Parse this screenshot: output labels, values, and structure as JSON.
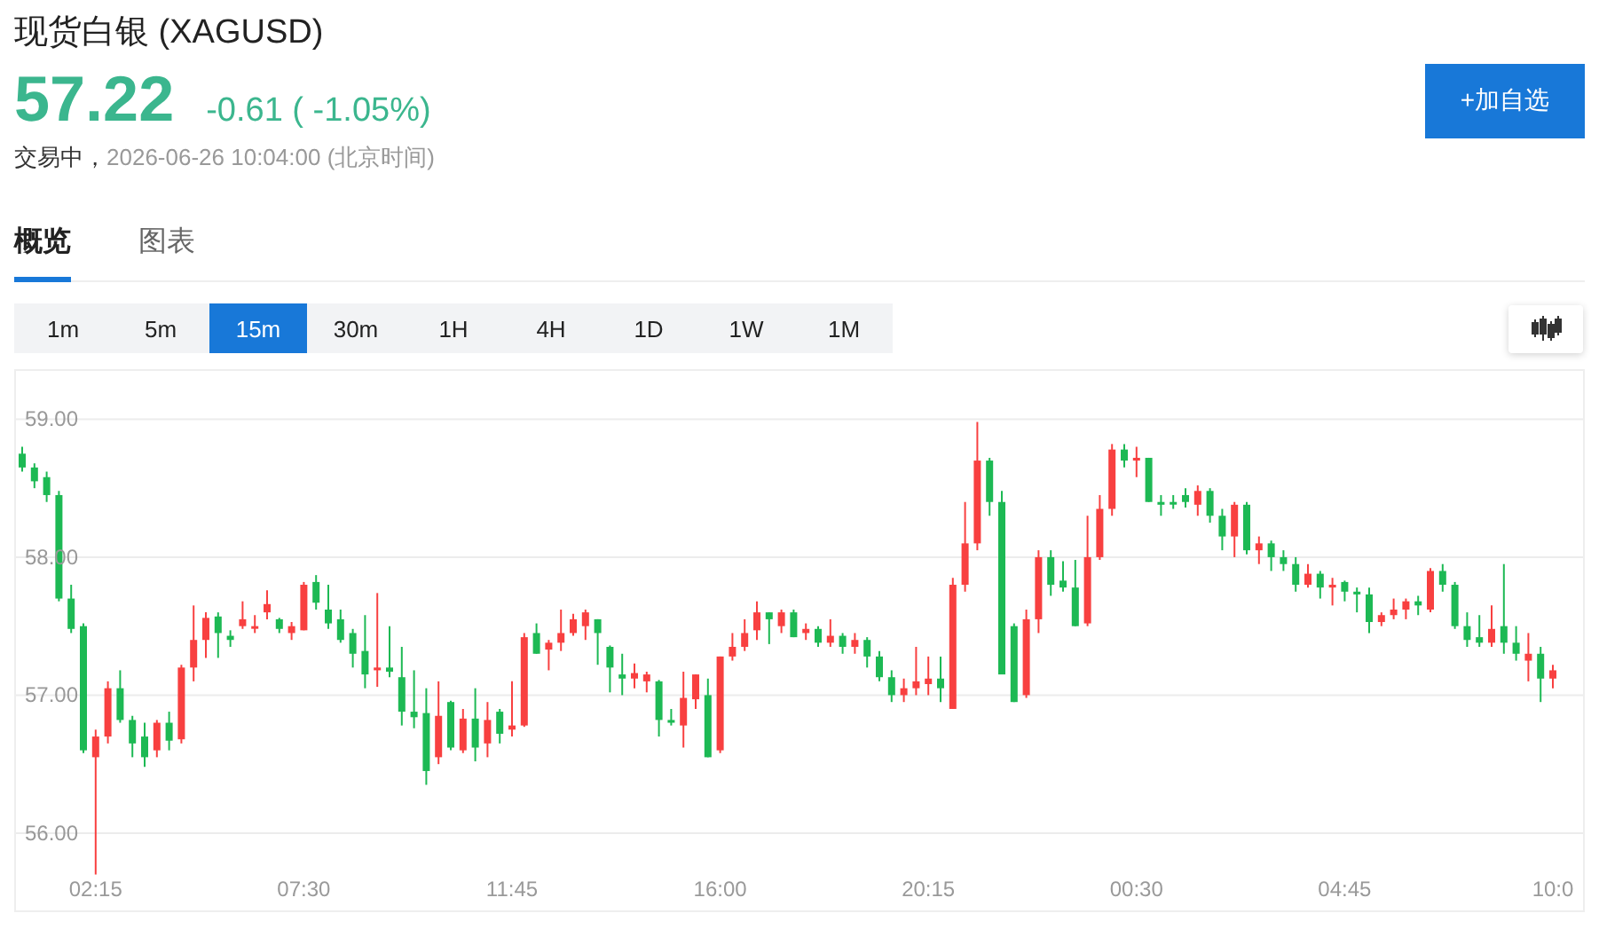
{
  "title": "现货白银 (XAGUSD)",
  "quote": {
    "price": "57.22",
    "change": "-0.61 ( -1.05%)"
  },
  "status": {
    "state": "交易中，",
    "time": "2026-06-26 10:04:00 (北京时间)"
  },
  "add_button": "+加自选",
  "tabs": [
    {
      "label": "概览",
      "selected": true
    },
    {
      "label": "图表",
      "selected": false
    }
  ],
  "intervals": [
    {
      "label": "1m",
      "selected": false
    },
    {
      "label": "5m",
      "selected": false
    },
    {
      "label": "15m",
      "selected": true
    },
    {
      "label": "30m",
      "selected": false
    },
    {
      "label": "1H",
      "selected": false
    },
    {
      "label": "4H",
      "selected": false
    },
    {
      "label": "1D",
      "selected": false
    },
    {
      "label": "1W",
      "selected": false
    },
    {
      "label": "1M",
      "selected": false
    }
  ],
  "chart": {
    "chart_data": {
      "type": "candlestick",
      "categories": [
        null,
        null,
        null,
        null,
        null,
        null,
        "02:15",
        null,
        null,
        null,
        null,
        null,
        null,
        null,
        null,
        null,
        null,
        null,
        null,
        null,
        null,
        null,
        null,
        "07:30",
        null,
        null,
        null,
        null,
        null,
        null,
        null,
        null,
        null,
        null,
        null,
        null,
        null,
        null,
        null,
        null,
        "11:45",
        null,
        null,
        null,
        null,
        null,
        null,
        null,
        null,
        null,
        null,
        null,
        null,
        null,
        null,
        null,
        null,
        "16:00",
        null,
        null,
        null,
        null,
        null,
        null,
        null,
        null,
        null,
        null,
        null,
        null,
        null,
        null,
        null,
        null,
        "20:15",
        null,
        null,
        null,
        null,
        null,
        null,
        null,
        null,
        null,
        null,
        null,
        null,
        null,
        null,
        null,
        null,
        "00:30",
        null,
        null,
        null,
        null,
        null,
        null,
        null,
        null,
        null,
        null,
        null,
        null,
        null,
        null,
        null,
        null,
        "04:45",
        null,
        null,
        null,
        null,
        null,
        null,
        null,
        null,
        null,
        null,
        null,
        null,
        null,
        null,
        null,
        null,
        "10:0"
      ],
      "ohlc": [
        [
          58.75,
          58.8,
          58.62,
          58.65
        ],
        [
          58.65,
          58.68,
          58.5,
          58.55
        ],
        [
          58.58,
          58.62,
          58.4,
          58.45
        ],
        [
          58.45,
          58.48,
          57.68,
          57.7
        ],
        [
          57.7,
          57.8,
          57.45,
          57.48
        ],
        [
          57.5,
          57.52,
          56.58,
          56.6
        ],
        [
          56.55,
          56.75,
          55.7,
          56.7
        ],
        [
          56.7,
          57.1,
          56.65,
          57.05
        ],
        [
          57.05,
          57.18,
          56.8,
          56.82
        ],
        [
          56.82,
          56.85,
          56.55,
          56.65
        ],
        [
          56.7,
          56.8,
          56.48,
          56.55
        ],
        [
          56.6,
          56.82,
          56.55,
          56.8
        ],
        [
          56.8,
          56.88,
          56.6,
          56.67
        ],
        [
          56.68,
          57.22,
          56.65,
          57.2
        ],
        [
          57.2,
          57.65,
          57.1,
          57.4
        ],
        [
          57.4,
          57.6,
          57.27,
          57.56
        ],
        [
          57.57,
          57.6,
          57.27,
          57.45
        ],
        [
          57.43,
          57.47,
          57.35,
          57.4
        ],
        [
          57.5,
          57.68,
          57.48,
          57.55
        ],
        [
          57.5,
          57.58,
          57.45,
          57.5
        ],
        [
          57.6,
          57.76,
          57.55,
          57.66
        ],
        [
          57.55,
          57.56,
          57.45,
          57.48
        ],
        [
          57.45,
          57.53,
          57.4,
          57.5
        ],
        [
          57.47,
          57.82,
          57.47,
          57.8
        ],
        [
          57.82,
          57.87,
          57.62,
          57.67
        ],
        [
          57.62,
          57.8,
          57.48,
          57.52
        ],
        [
          57.55,
          57.62,
          57.38,
          57.4
        ],
        [
          57.45,
          57.48,
          57.2,
          57.3
        ],
        [
          57.32,
          57.58,
          57.05,
          57.15
        ],
        [
          57.18,
          57.74,
          57.06,
          57.2
        ],
        [
          57.2,
          57.5,
          57.13,
          57.17
        ],
        [
          57.13,
          57.35,
          56.78,
          56.88
        ],
        [
          56.88,
          57.18,
          56.76,
          56.84
        ],
        [
          56.87,
          57.05,
          56.35,
          56.45
        ],
        [
          56.55,
          57.1,
          56.5,
          56.85
        ],
        [
          56.95,
          56.96,
          56.6,
          56.62
        ],
        [
          56.6,
          56.9,
          56.58,
          56.83
        ],
        [
          56.83,
          57.05,
          56.52,
          56.62
        ],
        [
          56.65,
          56.95,
          56.55,
          56.82
        ],
        [
          56.88,
          56.9,
          56.65,
          56.72
        ],
        [
          56.75,
          57.1,
          56.7,
          56.78
        ],
        [
          56.78,
          57.45,
          56.77,
          57.42
        ],
        [
          57.45,
          57.52,
          57.3,
          57.3
        ],
        [
          57.33,
          57.4,
          57.18,
          57.38
        ],
        [
          57.38,
          57.62,
          57.32,
          57.45
        ],
        [
          57.45,
          57.59,
          57.43,
          57.55
        ],
        [
          57.5,
          57.62,
          57.4,
          57.6
        ],
        [
          57.55,
          57.55,
          57.22,
          57.45
        ],
        [
          57.35,
          57.36,
          57.02,
          57.2
        ],
        [
          57.15,
          57.3,
          57.0,
          57.12
        ],
        [
          57.12,
          57.23,
          57.05,
          57.16
        ],
        [
          57.1,
          57.17,
          57.02,
          57.15
        ],
        [
          57.1,
          57.11,
          56.7,
          56.82
        ],
        [
          56.82,
          56.9,
          56.78,
          56.8
        ],
        [
          56.78,
          57.17,
          56.62,
          56.98
        ],
        [
          56.97,
          57.15,
          56.9,
          57.15
        ],
        [
          57.0,
          57.12,
          56.55,
          56.55
        ],
        [
          56.6,
          57.28,
          56.58,
          57.28
        ],
        [
          57.28,
          57.45,
          57.25,
          57.35
        ],
        [
          57.35,
          57.55,
          57.32,
          57.45
        ],
        [
          57.47,
          57.68,
          57.4,
          57.6
        ],
        [
          57.6,
          57.6,
          57.37,
          57.55
        ],
        [
          57.5,
          57.62,
          57.45,
          57.6
        ],
        [
          57.6,
          57.62,
          57.42,
          57.42
        ],
        [
          57.45,
          57.52,
          57.4,
          57.48
        ],
        [
          57.48,
          57.5,
          57.35,
          57.38
        ],
        [
          57.38,
          57.55,
          57.35,
          57.43
        ],
        [
          57.43,
          57.45,
          57.3,
          57.35
        ],
        [
          57.35,
          57.45,
          57.3,
          57.4
        ],
        [
          57.4,
          57.42,
          57.2,
          57.28
        ],
        [
          57.28,
          57.32,
          57.1,
          57.13
        ],
        [
          57.13,
          57.18,
          56.95,
          57.0
        ],
        [
          57.0,
          57.12,
          56.95,
          57.05
        ],
        [
          57.05,
          57.35,
          57.0,
          57.1
        ],
        [
          57.08,
          57.28,
          57.0,
          57.12
        ],
        [
          57.12,
          57.28,
          56.95,
          57.05
        ],
        [
          56.9,
          57.85,
          56.9,
          57.8
        ],
        [
          57.8,
          58.4,
          57.75,
          58.1
        ],
        [
          58.1,
          58.98,
          58.05,
          58.7
        ],
        [
          58.7,
          58.72,
          58.3,
          58.4
        ],
        [
          58.4,
          58.48,
          57.15,
          57.15
        ],
        [
          57.5,
          57.52,
          56.95,
          56.95
        ],
        [
          57.0,
          57.62,
          56.98,
          57.55
        ],
        [
          57.55,
          58.05,
          57.45,
          58.0
        ],
        [
          58.0,
          58.05,
          57.72,
          57.8
        ],
        [
          57.83,
          57.97,
          57.75,
          57.78
        ],
        [
          57.78,
          57.98,
          57.5,
          57.5
        ],
        [
          57.52,
          58.3,
          57.5,
          58.0
        ],
        [
          58.0,
          58.45,
          57.98,
          58.35
        ],
        [
          58.35,
          58.82,
          58.3,
          58.78
        ],
        [
          58.78,
          58.82,
          58.65,
          58.7
        ],
        [
          58.7,
          58.8,
          58.58,
          58.72
        ],
        [
          58.72,
          58.72,
          58.4,
          58.4
        ],
        [
          58.4,
          58.45,
          58.3,
          58.38
        ],
        [
          58.4,
          58.45,
          58.35,
          58.39
        ],
        [
          58.45,
          58.5,
          58.36,
          58.4
        ],
        [
          58.38,
          58.52,
          58.3,
          58.48
        ],
        [
          58.48,
          58.5,
          58.25,
          58.3
        ],
        [
          58.3,
          58.35,
          58.05,
          58.15
        ],
        [
          58.15,
          58.4,
          58.0,
          58.38
        ],
        [
          58.38,
          58.4,
          58.02,
          58.05
        ],
        [
          58.05,
          58.15,
          57.95,
          58.1
        ],
        [
          58.1,
          58.12,
          57.9,
          58.0
        ],
        [
          58.0,
          58.05,
          57.9,
          57.95
        ],
        [
          57.95,
          58.0,
          57.75,
          57.8
        ],
        [
          57.8,
          57.95,
          57.78,
          57.88
        ],
        [
          57.88,
          57.9,
          57.7,
          57.78
        ],
        [
          57.78,
          57.85,
          57.65,
          57.8
        ],
        [
          57.82,
          57.83,
          57.68,
          57.75
        ],
        [
          57.75,
          57.78,
          57.6,
          57.73
        ],
        [
          57.73,
          57.78,
          57.45,
          57.53
        ],
        [
          57.53,
          57.6,
          57.5,
          57.58
        ],
        [
          57.58,
          57.7,
          57.55,
          57.62
        ],
        [
          57.62,
          57.7,
          57.55,
          57.68
        ],
        [
          57.68,
          57.72,
          57.58,
          57.65
        ],
        [
          57.62,
          57.92,
          57.6,
          57.9
        ],
        [
          57.9,
          57.95,
          57.75,
          57.8
        ],
        [
          57.8,
          57.82,
          57.48,
          57.5
        ],
        [
          57.5,
          57.6,
          57.35,
          57.4
        ],
        [
          57.42,
          57.58,
          57.35,
          57.38
        ],
        [
          57.38,
          57.65,
          57.35,
          57.48
        ],
        [
          57.5,
          57.95,
          57.3,
          57.38
        ],
        [
          57.38,
          57.5,
          57.25,
          57.3
        ],
        [
          57.25,
          57.45,
          57.1,
          57.3
        ],
        [
          57.3,
          57.35,
          56.95,
          57.12
        ],
        [
          57.12,
          57.22,
          57.05,
          57.18
        ]
      ],
      "ylim": [
        55.44,
        59.35
      ],
      "grid": true,
      "yticks": [
        {
          "value": 59,
          "label": "59.00"
        },
        {
          "value": 58,
          "label": "58.00"
        },
        {
          "value": 57,
          "label": "57.00"
        },
        {
          "value": 56,
          "label": "56.00"
        }
      ]
    }
  }
}
